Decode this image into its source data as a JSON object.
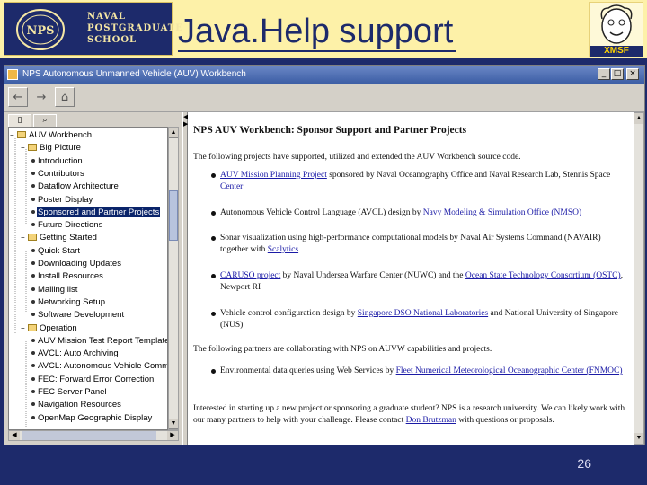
{
  "slide": {
    "title": "Java.Help support",
    "page_number": "26",
    "school": [
      "NAVAL",
      "POSTGRADUATE",
      "SCHOOL"
    ],
    "seal_text": "NPS",
    "partner_logo": "XMSF",
    "colors": {
      "header_bg": "#fdf1a8",
      "navy": "#1d2a6b"
    }
  },
  "window": {
    "title": "NPS Autonomous Unmanned Vehicle (AUV) Workbench",
    "controls": {
      "minimize": "_",
      "maximize": "□",
      "close": "×"
    }
  },
  "toolbar": {
    "icons": [
      "back-arrow-icon",
      "forward-arrow-icon",
      "home-icon"
    ]
  },
  "navigator": {
    "tabs": [
      "contents-tab",
      "search-tab"
    ],
    "tree": [
      {
        "label": "AUV Workbench",
        "level": 0,
        "type": "folder",
        "expanded": true
      },
      {
        "label": "Big Picture",
        "level": 1,
        "type": "folder",
        "expanded": true
      },
      {
        "label": "Introduction",
        "level": 2,
        "type": "page"
      },
      {
        "label": "Contributors",
        "level": 2,
        "type": "page"
      },
      {
        "label": "Dataflow Architecture",
        "level": 2,
        "type": "page"
      },
      {
        "label": "Poster Display",
        "level": 2,
        "type": "page"
      },
      {
        "label": "Sponsored and Partner Projects",
        "level": 2,
        "type": "page",
        "selected": true
      },
      {
        "label": "Future Directions",
        "level": 2,
        "type": "page"
      },
      {
        "label": "Getting Started",
        "level": 1,
        "type": "folder",
        "expanded": true
      },
      {
        "label": "Quick Start",
        "level": 2,
        "type": "page"
      },
      {
        "label": "Downloading Updates",
        "level": 2,
        "type": "page"
      },
      {
        "label": "Install Resources",
        "level": 2,
        "type": "page"
      },
      {
        "label": "Mailing list",
        "level": 2,
        "type": "page"
      },
      {
        "label": "Networking Setup",
        "level": 2,
        "type": "page"
      },
      {
        "label": "Software Development",
        "level": 2,
        "type": "page"
      },
      {
        "label": "Operation",
        "level": 1,
        "type": "folder",
        "expanded": true
      },
      {
        "label": "AUV Mission Test Report Template",
        "level": 2,
        "type": "page"
      },
      {
        "label": "AVCL: Auto Archiving",
        "level": 2,
        "type": "page"
      },
      {
        "label": "AVCL: Autonomous Vehicle Command Language",
        "level": 2,
        "type": "page"
      },
      {
        "label": "FEC: Forward Error Correction",
        "level": 2,
        "type": "page"
      },
      {
        "label": "FEC Server Panel",
        "level": 2,
        "type": "page"
      },
      {
        "label": "Navigation Resources",
        "level": 2,
        "type": "page"
      },
      {
        "label": "OpenMap Geographic Display",
        "level": 2,
        "type": "page"
      }
    ]
  },
  "content": {
    "heading": "NPS AUV Workbench: Sponsor Support and Partner Projects",
    "intro": "The following projects have supported, utilized and extended the AUV Workbench source code.",
    "projects": [
      {
        "link1": "AUV Mission Planning Project",
        "text1": " sponsored by Naval Oceanography Office and Naval Research Lab, Stennis Space ",
        "link2": "Center",
        "text2": ""
      },
      {
        "link1": "",
        "text1": "Autonomous Vehicle Control Language (AVCL) design by ",
        "link2": "Navy Modeling & Simulation Office (NMSO)",
        "text2": ""
      },
      {
        "link1": "",
        "text1": "Sonar visualization using high-performance computational models by Naval Air Systems Command (NAVAIR) together with ",
        "link2": "Scalytics",
        "text2": ""
      },
      {
        "link1": "CARUSO project",
        "text1": " by Naval Undersea Warfare Center (NUWC) and the ",
        "link2": "Ocean State Technology Consortium (OSTC)",
        "text2": ", Newport RI"
      },
      {
        "link1": "",
        "text1": "Vehicle control configuration design by ",
        "link2": "Singapore DSO National Laboratories",
        "text2": " and National University of Singapore (NUS)"
      }
    ],
    "partners_intro": "The following partners are collaborating with NPS on AUVW capabilities and projects.",
    "partners": [
      {
        "text1": "Environmental data queries using Web Services by ",
        "link": "Fleet Numerical Meteorological Oceanographic Center (FNMOC)"
      }
    ],
    "closing": "Interested in starting up a new project or sponsoring a graduate student? NPS is a research university. We can likely work with our many partners to help with your challenge. Please contact ",
    "closing_link": "Don Brutzman",
    "closing_tail": " with questions or proposals."
  }
}
